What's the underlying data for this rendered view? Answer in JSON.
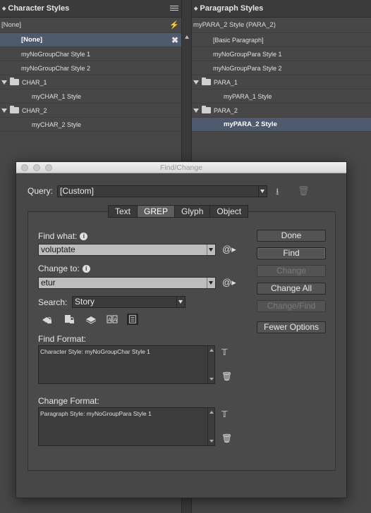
{
  "char_panel": {
    "title": "Character Styles",
    "selected_style": "[None]",
    "items": [
      {
        "label": "[None]"
      },
      {
        "label": "myNoGroupChar Style 1"
      },
      {
        "label": "myNoGroupChar Style 2"
      },
      {
        "label": "CHAR_1"
      },
      {
        "label": "myCHAR_1 Style"
      },
      {
        "label": "CHAR_2"
      },
      {
        "label": "myCHAR_2 Style"
      }
    ]
  },
  "para_panel": {
    "title": "Paragraph Styles",
    "selected_style": "myPARA_2 Style (PARA_2)",
    "items": [
      {
        "label": "[Basic Paragraph]"
      },
      {
        "label": "myNoGroupPara Style 1"
      },
      {
        "label": "myNoGroupPara Style 2"
      },
      {
        "label": "PARA_1"
      },
      {
        "label": "myPARA_1 Style"
      },
      {
        "label": "PARA_2"
      },
      {
        "label": "myPARA_2 Style"
      }
    ]
  },
  "dialog": {
    "title": "Find/Change",
    "query_label": "Query:",
    "query_value": "[Custom]",
    "tabs": [
      "Text",
      "GREP",
      "Glyph",
      "Object"
    ],
    "active_tab": "GREP",
    "find_what_label": "Find what:",
    "find_what_value": "voluptate",
    "change_to_label": "Change to:",
    "change_to_value": "etur",
    "search_label": "Search:",
    "search_value": "Story",
    "find_format_label": "Find Format:",
    "find_format_value": "Character Style: myNoGroupChar Style 1",
    "change_format_label": "Change Format:",
    "change_format_value": "Paragraph Style: myNoGroupPara Style 1",
    "buttons": {
      "done": "Done",
      "find": "Find",
      "change": "Change",
      "change_all": "Change All",
      "change_find": "Change/Find",
      "fewer_options": "Fewer Options"
    }
  }
}
